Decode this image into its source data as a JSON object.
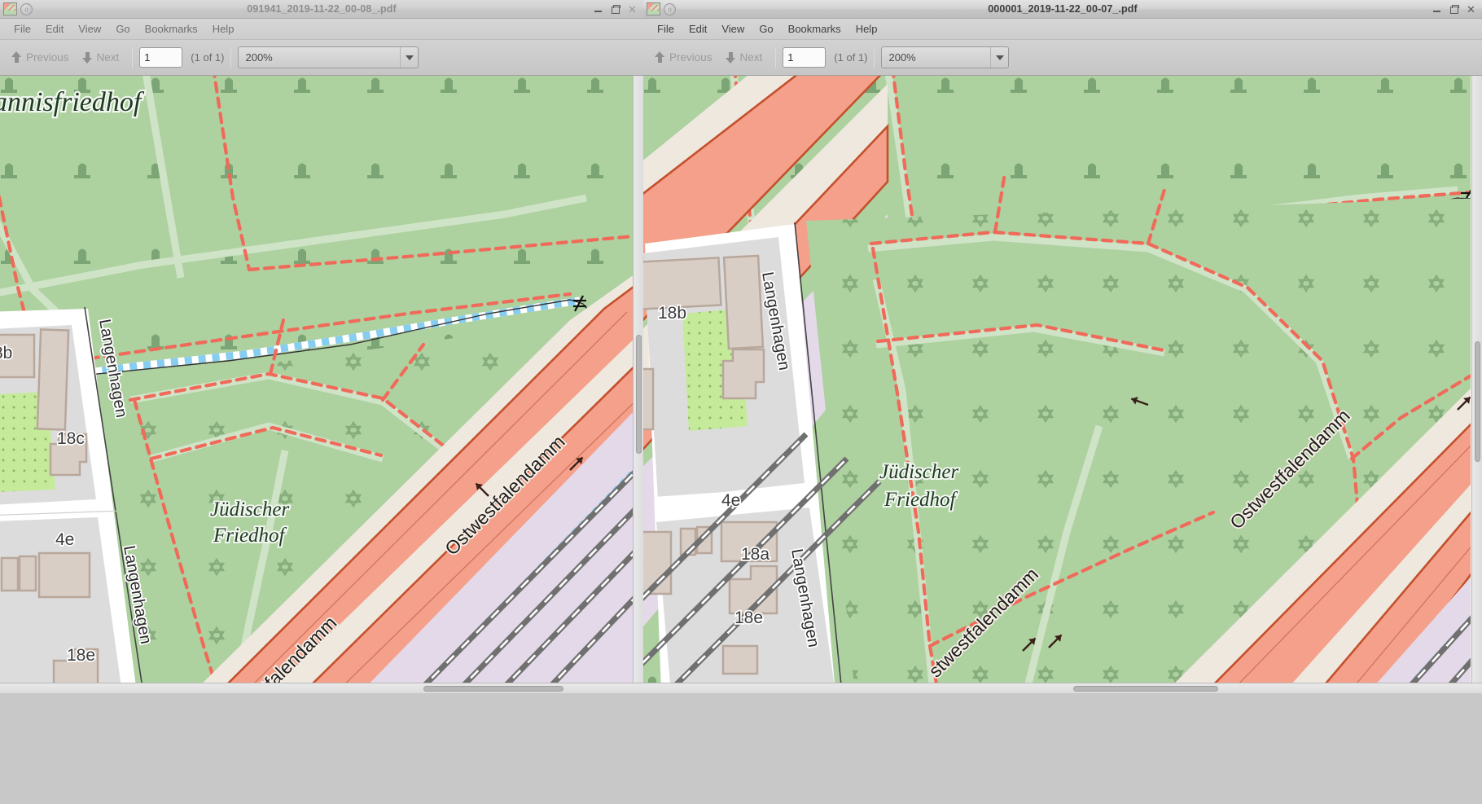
{
  "desktop": {
    "background_color": "#4a4a4a"
  },
  "windows": [
    {
      "id": "left",
      "active": false,
      "title": "091941_2019-11-22_00-08_.pdf",
      "app_icon": "map-thumbnail-icon",
      "controls": {
        "minimize": "minimize-icon",
        "maximize": "maximize-icon",
        "close": "close-icon"
      },
      "menus": [
        "File",
        "Edit",
        "View",
        "Go",
        "Bookmarks",
        "Help"
      ],
      "toolbar": {
        "previous_label": "Previous",
        "next_label": "Next",
        "page_value": "1",
        "page_total": "(1 of 1)",
        "zoom_value": "200%"
      },
      "map": {
        "title_labels": [
          "annisfriedhof",
          "Jüdischer Friedhof"
        ],
        "street_labels": [
          "Langenhagen",
          "Langenhagen",
          "Ostwestfalendamm",
          "tfalendamm"
        ],
        "house_numbers": [
          "8b",
          "18c",
          "4e",
          "18e"
        ],
        "features": [
          "cemetery-area",
          "jewish-cemetery",
          "motorway",
          "railway",
          "footpath",
          "grave-markers",
          "star-of-david-markers"
        ]
      }
    },
    {
      "id": "right",
      "active": true,
      "title": "000001_2019-11-22_00-07_.pdf",
      "app_icon": "map-thumbnail-icon",
      "controls": {
        "minimize": "minimize-icon",
        "maximize": "maximize-icon",
        "close": "close-icon"
      },
      "menus": [
        "File",
        "Edit",
        "View",
        "Go",
        "Bookmarks",
        "Help"
      ],
      "toolbar": {
        "previous_label": "Previous",
        "next_label": "Next",
        "page_value": "1",
        "page_total": "(1 of 1)",
        "zoom_value": "200%"
      },
      "map": {
        "title_labels": [
          "Jüdischer Friedhof"
        ],
        "street_labels": [
          "Langenhagen",
          "Langenhagen",
          "Ostwestfalendamm",
          "stwestfalendamm"
        ],
        "house_numbers": [
          "18b",
          "4e",
          "18a",
          "18e"
        ],
        "features": [
          "cemetery-area",
          "jewish-cemetery",
          "motorway",
          "railway",
          "footpath",
          "grave-markers",
          "star-of-david-markers"
        ]
      }
    }
  ],
  "colors": {
    "cemetery_green": "#aed1a0",
    "grave_marker": "#6a9464",
    "boundary_red": "#f06a5a",
    "motorway_fill": "#f4a08a",
    "motorway_casing": "#c4502c",
    "building": "#d9cec6",
    "building_outline": "#b8a79b",
    "residential": "#dcdcdc",
    "railway_area": "#e4d9e9",
    "railway_track": "#707070",
    "road_white": "#ffffff",
    "waterway_blue": "#87cdf0",
    "orchard_green": "#c5ea9a",
    "motorway_link": "#efe8df"
  }
}
